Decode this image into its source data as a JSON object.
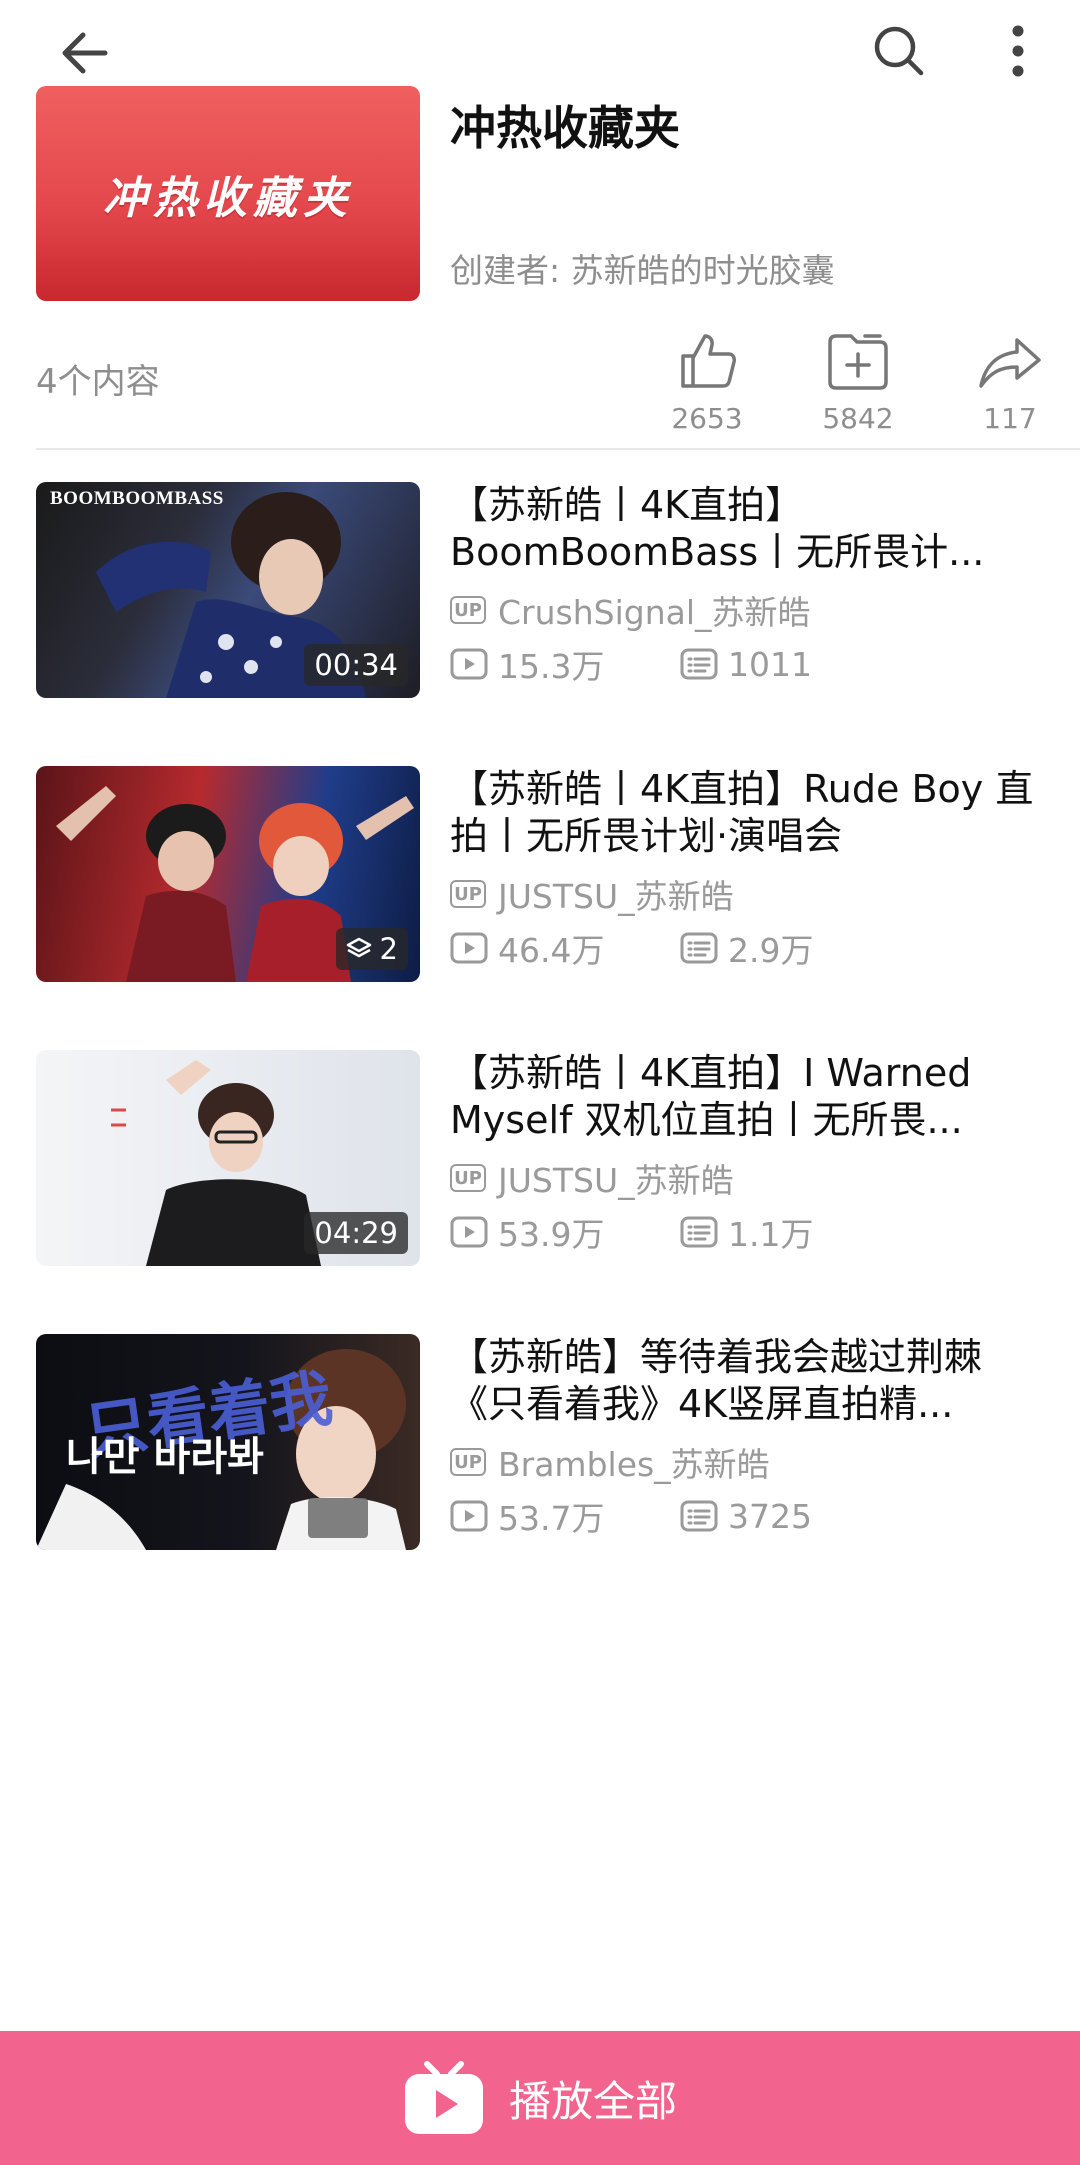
{
  "collection": {
    "cover_text": "冲热收藏夹",
    "title": "冲热收藏夹",
    "creator": "创建者: 苏新皓的时光胶囊",
    "count": "4个内容",
    "likes": "2653",
    "favorites": "5842",
    "shares": "117"
  },
  "videos": [
    {
      "title": "【苏新皓丨4K直拍】BoomBoomBass丨无所畏计...",
      "uploader": "CrushSignal_苏新皓",
      "views": "15.3万",
      "danmaku": "1011",
      "badge": "00:34",
      "thumb_label": "BOOMBOOMBASS"
    },
    {
      "title": "【苏新皓丨4K直拍】Rude Boy 直拍丨无所畏计划·演唱会",
      "uploader": "JUSTSU_苏新皓",
      "views": "46.4万",
      "danmaku": "2.9万",
      "badge": "2"
    },
    {
      "title": "【苏新皓丨4K直拍】I Warned Myself 双机位直拍丨无所畏...",
      "uploader": "JUSTSU_苏新皓",
      "views": "53.9万",
      "danmaku": "1.1万",
      "badge": "04:29"
    },
    {
      "title": "【苏新皓】等待着我会越过荆棘《只看着我》4K竖屏直拍精...",
      "uploader": "Brambles_苏新皓",
      "views": "53.7万",
      "danmaku": "3725",
      "thumb_label_kr": "나만 바라봐",
      "thumb_label_cn": "只看着我"
    }
  ],
  "up_label": "UP",
  "play_all": "播放全部",
  "colors": {
    "accent": "#f2648e",
    "cover": "#e4484d",
    "muted": "#8e8e8e"
  }
}
